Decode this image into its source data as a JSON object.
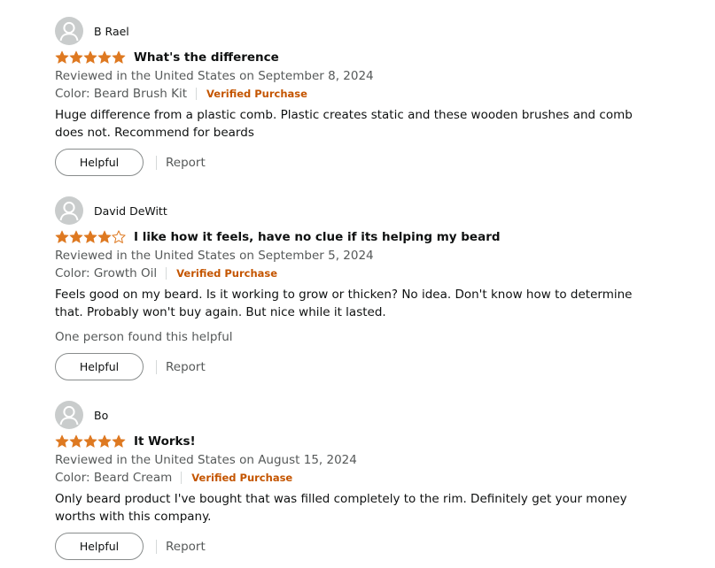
{
  "colors": {
    "star_fill": "#de7921",
    "verified": "#c45500",
    "muted_text": "#565959",
    "text": "#0f1111"
  },
  "icons": {
    "avatar": "person-silhouette-icon",
    "star": "star-icon"
  },
  "reviews": [
    {
      "reviewer": "B Rael",
      "rating": 5,
      "title": "What's the difference",
      "reviewed_in": "Reviewed in the United States on September 8, 2024",
      "variant": "Color: Beard Brush Kit",
      "verified": "Verified Purchase",
      "body": "Huge difference from a plastic comb. Plastic creates static and these wooden brushes and comb does not. Recommend for beards",
      "helpful_count": "",
      "helpful_label": "Helpful",
      "report_label": "Report"
    },
    {
      "reviewer": "David DeWitt",
      "rating": 4,
      "title": "I like how it feels, have no clue if its helping my beard",
      "reviewed_in": "Reviewed in the United States on September 5, 2024",
      "variant": "Color: Growth Oil",
      "verified": "Verified Purchase",
      "body": "Feels good on my beard. Is it working to grow or thicken? No idea. Don't know how to determine that. Probably won't buy again. But nice while it lasted.",
      "helpful_count": "One person found this helpful",
      "helpful_label": "Helpful",
      "report_label": "Report"
    },
    {
      "reviewer": "Bo",
      "rating": 5,
      "title": "It Works!",
      "reviewed_in": "Reviewed in the United States on August 15, 2024",
      "variant": "Color: Beard Cream",
      "verified": "Verified Purchase",
      "body": "Only beard product I've bought that was filled completely to the rim. Definitely get your money worths with this company.",
      "helpful_count": "",
      "helpful_label": "Helpful",
      "report_label": "Report"
    }
  ]
}
